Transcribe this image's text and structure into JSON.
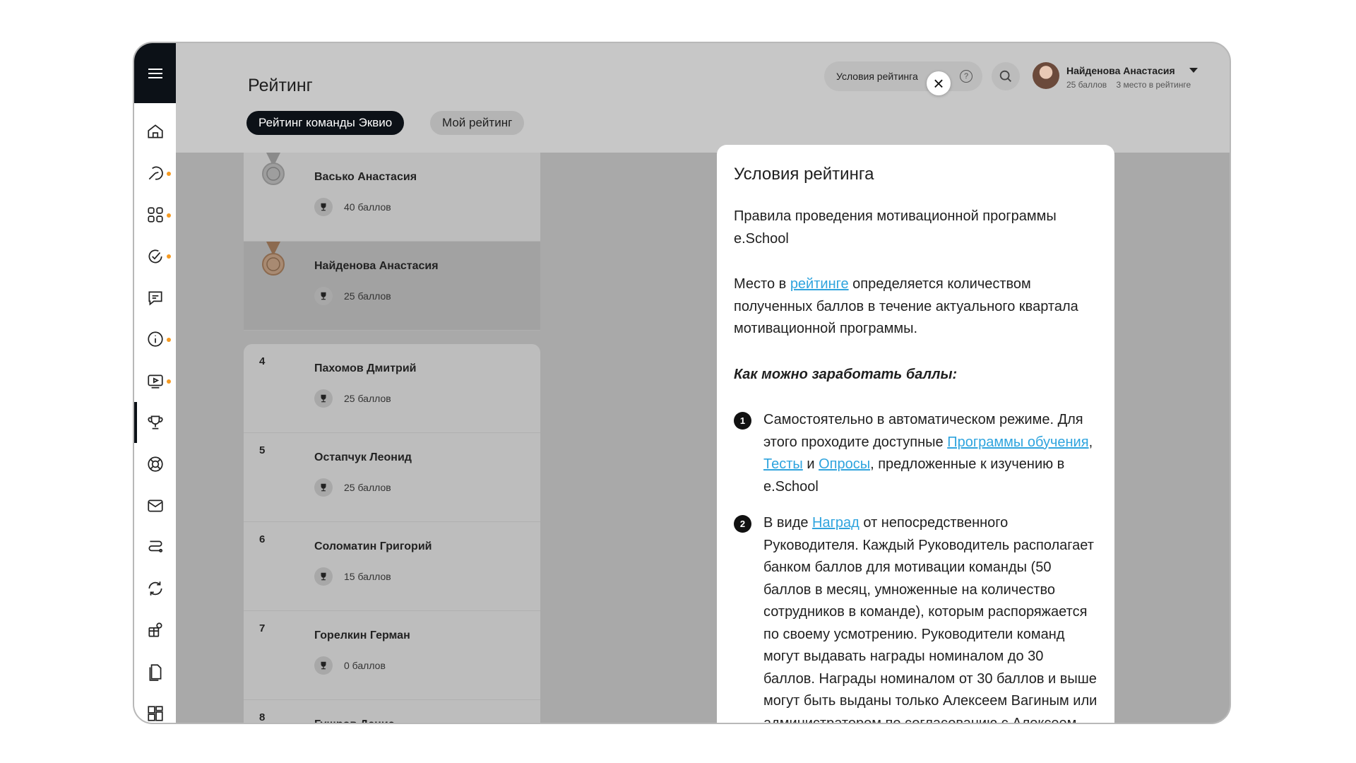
{
  "page": {
    "title": "Рейтинг"
  },
  "tabs": [
    {
      "label": "Рейтинг команды Эквио",
      "active": true
    },
    {
      "label": "Мой рейтинг",
      "active": false
    }
  ],
  "header": {
    "conditions_label": "Условия рейтинга",
    "help_glyph": "?",
    "close_glyph": "×"
  },
  "user": {
    "name": "Найденова Анастасия",
    "points": "25 баллов",
    "place": "3 место в рейтинге"
  },
  "top_ranking": [
    {
      "rank": "2",
      "name": "Васько Анастасия",
      "score": "40 баллов",
      "medal": "silver"
    },
    {
      "rank": "3",
      "name": "Найденова Анастасия",
      "score": "25 баллов",
      "medal": "bronze"
    }
  ],
  "ranking": [
    {
      "rank": "4",
      "name": "Пахомов Дмитрий",
      "score": "25 баллов"
    },
    {
      "rank": "5",
      "name": "Остапчук Леонид",
      "score": "25 баллов"
    },
    {
      "rank": "6",
      "name": "Соломатин Григорий",
      "score": "15 баллов"
    },
    {
      "rank": "7",
      "name": "Горелкин Герман",
      "score": "0 баллов"
    },
    {
      "rank": "8",
      "name": "Гущров Денис",
      "score": ""
    }
  ],
  "modal": {
    "title": "Условия рейтинга",
    "intro": "Правила проведения мотивационной программы e.School",
    "p2_before": "Место в ",
    "p2_link": "рейтинге",
    "p2_after": " определяется количеством полученных баллов в течение актуального квартала мотивационной программы.",
    "subhead": "Как можно заработать баллы:",
    "step1": {
      "num": "1",
      "text_a": "Самостоятельно в автоматическом режиме. Для этого проходите доступные ",
      "link_a": "Программы обучения",
      "sep": ", ",
      "link_b": "Тесты",
      "and": " и ",
      "link_c": "Опросы",
      "text_b": ", предложенные к изучению в e.School"
    },
    "step2": {
      "num": "2",
      "text_a": "В виде ",
      "link": "Наград",
      "text_b": " от непосредственного Руководителя. Каждый Руководитель располагает банком баллов для мотивации команды (50 баллов в месяц, умноженные на количество сотрудников в команде), которым распоряжается по своему усмотрению. Руководители команд могут выдавать награды номиналом до 30 баллов. Награды номиналом от 30 баллов и выше могут быть выданы только Алексеем Вагиным или администратором по согласованию с",
      "text_c": "Алексеем Вагиным."
    }
  },
  "sidebar": {
    "icons": [
      {
        "name": "home-icon",
        "dot": false
      },
      {
        "name": "route-icon",
        "dot": true
      },
      {
        "name": "apps-icon",
        "dot": true
      },
      {
        "name": "check-icon",
        "dot": true
      },
      {
        "name": "chat-icon",
        "dot": false
      },
      {
        "name": "info-icon",
        "dot": true
      },
      {
        "name": "video-icon",
        "dot": true
      },
      {
        "name": "trophy-icon",
        "dot": false,
        "active": true
      },
      {
        "name": "support-icon",
        "dot": false
      },
      {
        "name": "mail-icon",
        "dot": false
      },
      {
        "name": "path-icon",
        "dot": false
      },
      {
        "name": "sync-icon",
        "dot": false
      },
      {
        "name": "gift-icon",
        "dot": false
      },
      {
        "name": "document-icon",
        "dot": false
      },
      {
        "name": "dashboard-icon",
        "dot": false
      }
    ]
  },
  "colors": {
    "accent": "#0c1117",
    "link": "#2fa4de",
    "notify_dot": "#f59b23"
  }
}
